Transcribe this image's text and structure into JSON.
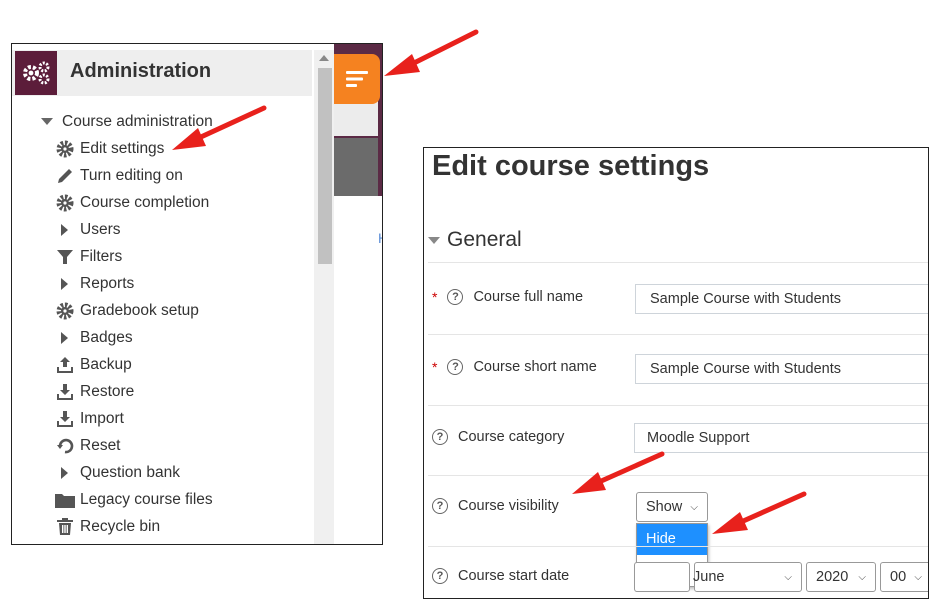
{
  "admin": {
    "title": "Administration",
    "items": [
      {
        "label": "Course administration",
        "icon": "caret-down-icon"
      },
      {
        "label": "Edit settings",
        "icon": "gear-icon"
      },
      {
        "label": "Turn editing on",
        "icon": "pencil-icon"
      },
      {
        "label": "Course completion",
        "icon": "gear-icon"
      },
      {
        "label": "Users",
        "icon": "caret-right-icon"
      },
      {
        "label": "Filters",
        "icon": "filter-icon"
      },
      {
        "label": "Reports",
        "icon": "caret-right-icon"
      },
      {
        "label": "Gradebook setup",
        "icon": "gear-icon"
      },
      {
        "label": "Badges",
        "icon": "caret-right-icon"
      },
      {
        "label": "Backup",
        "icon": "upload-icon"
      },
      {
        "label": "Restore",
        "icon": "download-icon"
      },
      {
        "label": "Import",
        "icon": "download-icon"
      },
      {
        "label": "Reset",
        "icon": "reset-icon"
      },
      {
        "label": "Question bank",
        "icon": "caret-right-icon"
      },
      {
        "label": "Legacy course files",
        "icon": "folder-icon"
      },
      {
        "label": "Recycle bin",
        "icon": "trash-icon"
      }
    ],
    "stray_letter": "H",
    "accent": "#f58220",
    "brand": "#5c1d3a"
  },
  "edit": {
    "title": "Edit course settings",
    "section": "General",
    "fields": {
      "full_name_label": "Course full name",
      "full_name_value": "Sample Course with Students",
      "short_name_label": "Course short name",
      "short_name_value": "Sample Course with Students",
      "category_label": "Course category",
      "category_value": "Moodle Support",
      "visibility_label": "Course visibility",
      "visibility_value": "Show",
      "visibility_options": [
        "Hide",
        "Show"
      ],
      "start_date_label": "Course start date",
      "start_month": "June",
      "start_year": "2020",
      "start_hour": "00"
    },
    "required_mark": "*"
  }
}
